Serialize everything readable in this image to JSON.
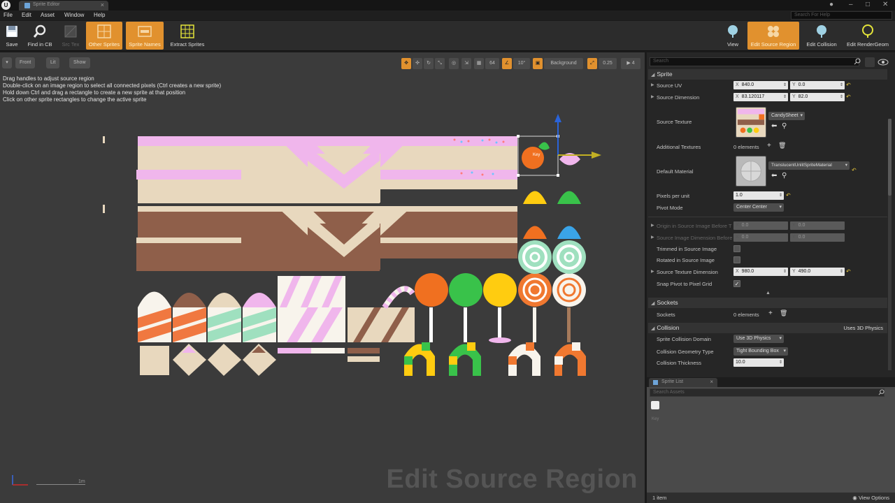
{
  "window": {
    "tab_title": "Sprite Editor",
    "help_search_placeholder": "Search For Help",
    "controls": {
      "minimize": "–",
      "maximize": "□",
      "close": "✕"
    }
  },
  "menu": [
    "File",
    "Edit",
    "Asset",
    "Window",
    "Help"
  ],
  "toolbar": {
    "save": "Save",
    "find_in_cb": "Find in CB",
    "src_tex": "Src Tex",
    "other_sprites": "Other Sprites",
    "sprite_names": "Sprite Names",
    "extract_sprites": "Extract Sprites",
    "view": "View",
    "edit_source_region": "Edit Source Region",
    "edit_collision": "Edit Collision",
    "edit_render_geom": "Edit RenderGeom"
  },
  "viewport": {
    "view_mode": "Front",
    "lighting": "Lit",
    "show": "Show",
    "grid_snap": "64",
    "rotation_snap": "10°",
    "background": "Background",
    "scale_snap": "0.25",
    "camera_speed": "4",
    "hints": [
      "Drag handles to adjust source region",
      "Double-click on an image region to select all connected pixels (Ctrl creates a new sprite)",
      "Hold down Ctrl and drag a rectangle to create a new sprite at that position",
      "Click on other sprite rectangles to change the active sprite"
    ],
    "selected_sprite_label": "Key",
    "mode_watermark": "Edit Source Region",
    "scale_label": "1m"
  },
  "details": {
    "search_placeholder": "Search",
    "sprite_section": "Sprite",
    "source_uv": {
      "label": "Source UV",
      "x": "840.0",
      "y": "0.0"
    },
    "source_dimension": {
      "label": "Source Dimension",
      "x": "83.120117",
      "y": "82.0"
    },
    "source_texture": {
      "label": "Source Texture",
      "value": "CandySheet"
    },
    "additional_textures": {
      "label": "Additional Textures",
      "value": "0 elements"
    },
    "default_material": {
      "label": "Default Material",
      "value": "TranslucentUnlitSpriteMaterial"
    },
    "pixels_per_unit": {
      "label": "Pixels per unit",
      "value": "1.0"
    },
    "pivot_mode": {
      "label": "Pivot Mode",
      "value": "Center Center"
    },
    "origin_in_source": {
      "label": "Origin in Source Image Before T",
      "x": "0.0",
      "y": "0.0"
    },
    "source_image_dim_before": {
      "label": "Source Image Dimension Before",
      "x": "0.0",
      "y": "0.0"
    },
    "trimmed": {
      "label": "Trimmed in Source Image",
      "checked": false
    },
    "rotated": {
      "label": "Rotated in Source Image",
      "checked": false
    },
    "source_texture_dimension": {
      "label": "Source Texture Dimension",
      "x": "980.0",
      "y": "490.0"
    },
    "snap_pivot": {
      "label": "Snap Pivot to Pixel Grid",
      "checked": true
    },
    "sockets_section": "Sockets",
    "sockets": {
      "label": "Sockets",
      "value": "0 elements"
    },
    "collision_section": "Collision",
    "collision_note": "Uses 3D Physics",
    "sprite_collision_domain": {
      "label": "Sprite Collision Domain",
      "value": "Use 3D Physics"
    },
    "collision_geometry_type": {
      "label": "Collision Geometry Type",
      "value": "Tight Bounding Box"
    },
    "collision_thickness": {
      "label": "Collision Thickness",
      "value": "10.0"
    },
    "axis_x": "X",
    "axis_y": "Y"
  },
  "sprite_list": {
    "tab": "Sprite List",
    "search_placeholder": "Search Assets",
    "item_label": "Key",
    "count": "1 item",
    "view_options": "View Options"
  },
  "colors": {
    "accent_orange": "#e1912e",
    "panel_bg": "#262626",
    "viewport_bg": "#3b3b3b"
  }
}
